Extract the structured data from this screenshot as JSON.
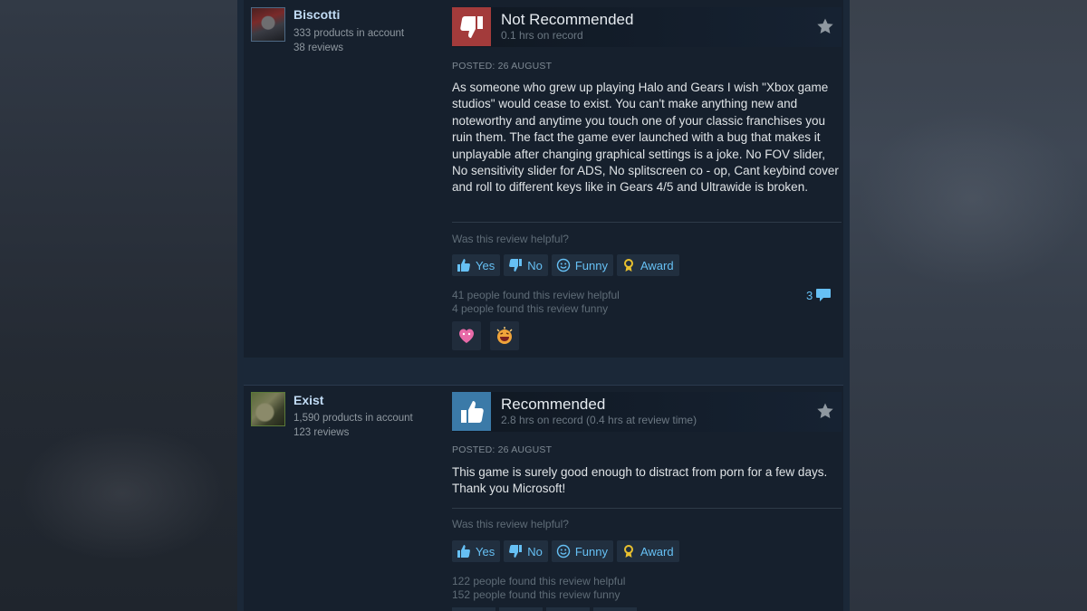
{
  "reviews": [
    {
      "author": "Biscotti",
      "products": "333 products in account",
      "review_count": "38 reviews",
      "verdict": "Not Recommended",
      "hours": "0.1 hrs on record",
      "posted": "POSTED: 26 AUGUST",
      "text": "As someone who grew up playing Halo and Gears I wish \"Xbox game studios\" would cease to exist. You can't make anything new and noteworthy and anytime you touch one of your classic franchises you ruin them. The fact the game ever launched with a bug that makes it unplayable after changing graphical settings is a joke. No FOV slider, No sensitivity slider for ADS, No splitscreen co - op, Cant keybind cover and roll to different keys like in Gears 4/5 and Ultrawide is broken.",
      "helpful_question": "Was this review helpful?",
      "buttons": {
        "yes": "Yes",
        "no": "No",
        "funny": "Funny",
        "award": "Award"
      },
      "helpful_count": "41 people found this review helpful",
      "funny_count": "4 people found this review funny",
      "comments": "3",
      "awards": [
        "heart-award-icon",
        "laughing-award-icon"
      ]
    },
    {
      "author": "Exist",
      "products": "1,590 products in account",
      "review_count": "123 reviews",
      "verdict": "Recommended",
      "hours": "2.8 hrs on record (0.4 hrs at review time)",
      "posted": "POSTED: 26 AUGUST",
      "text": "This game is surely good enough to distract from porn for a few days. Thank you Microsoft!",
      "helpful_question": "Was this review helpful?",
      "buttons": {
        "yes": "Yes",
        "no": "No",
        "funny": "Funny",
        "award": "Award"
      },
      "helpful_count": "122 people found this review helpful",
      "funny_count": "152 people found this review funny"
    }
  ],
  "colors": {
    "link": "#66c0f4",
    "not_recommended": "#a33b3b",
    "recommended": "#3b7aa8",
    "panel": "#16202d"
  }
}
